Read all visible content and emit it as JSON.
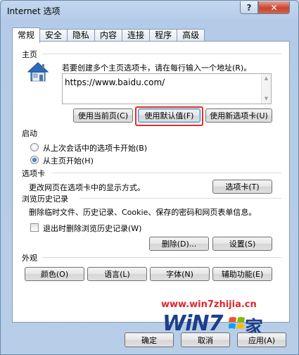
{
  "window": {
    "title": "Internet 选项"
  },
  "titlebar": {
    "help_label": "?",
    "close_label": "✕"
  },
  "tabs": [
    "常规",
    "安全",
    "隐私",
    "内容",
    "连接",
    "程序",
    "高级"
  ],
  "homepage": {
    "title": "主页",
    "instruction": "若要创建多个主页选项卡，请在每行输入一个地址(R)。",
    "url": "https://www.baidu.com/",
    "use_current": "使用当前页(C)",
    "use_default": "使用默认值(F)",
    "use_new_tab": "使用新选项卡(U)"
  },
  "startup": {
    "title": "启动",
    "option_last_session": "从上次会话中的选项卡开始(B)",
    "option_homepage": "从主页开始(H)",
    "selected": "option_homepage"
  },
  "tabs_section": {
    "title": "选项卡",
    "description": "更改网页在选项卡中的显示方式。",
    "button": "选项卡(T)"
  },
  "history": {
    "title": "浏览历史记录",
    "description": "删除临时文件、历史记录、Cookie、保存的密码和网页表单信息。",
    "checkbox_label": "退出时删除浏览历史记录(W)",
    "checkbox_checked": false,
    "delete_button": "删除(D)...",
    "settings_button": "设置(S)"
  },
  "appearance": {
    "title": "外观",
    "colors": "颜色(O)",
    "languages": "语言(L)",
    "fonts": "字体(N)",
    "accessibility": "辅助功能(E)"
  },
  "footer": {
    "ok": "确定",
    "cancel": "取消",
    "apply": "应用(A)"
  },
  "watermark": {
    "url": "www.win7zhijia.cn",
    "logo": "WiN7",
    "jia": "家"
  },
  "colors": {
    "highlight": "#e12a2a",
    "window": "#b7cde8",
    "watermark_url": "#e0262c",
    "watermark_logo": "#1b3f8b"
  }
}
